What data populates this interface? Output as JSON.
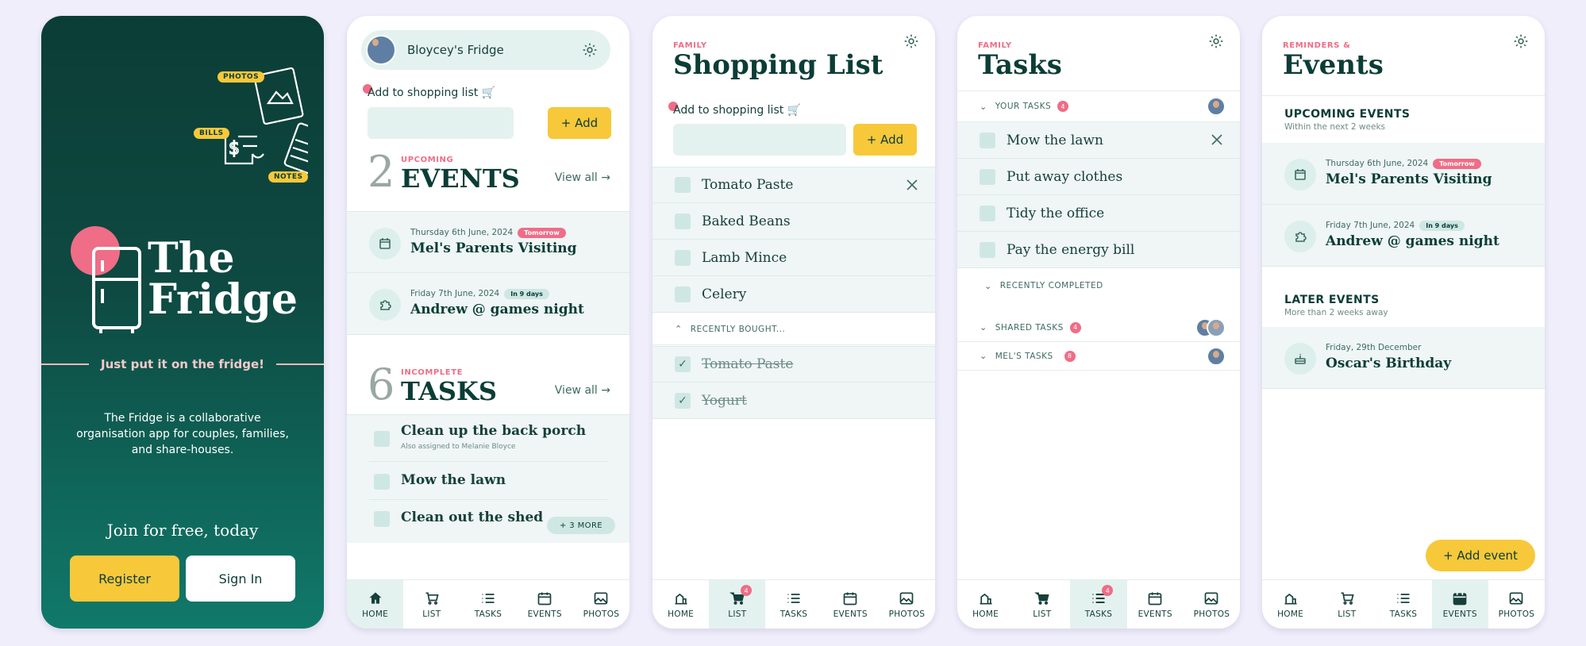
{
  "welcome": {
    "doodle_tags": [
      "PHOTOS",
      "BILLS",
      "NOTES"
    ],
    "logo_line1": "The",
    "logo_line2": "Fridge",
    "tagline": "Just put it on the fridge!",
    "about": "The Fridge is a collaborative organisation app for couples, families, and share-houses.",
    "join": "Join for free, today",
    "register": "Register",
    "sign_in": "Sign In"
  },
  "home": {
    "fridge_name": "Bloycey's Fridge",
    "add_label": "Add to shopping list",
    "add_btn": "+ Add",
    "events_count": "2",
    "events_kicker": "UPCOMING",
    "events_title": "EVENTS",
    "view_all": "View all →",
    "events": [
      {
        "date": "Thursday 6th June, 2024",
        "pill": "Tomorrow",
        "title": "Mel's Parents Visiting",
        "icon": "calendar-icon"
      },
      {
        "date": "Friday 7th June, 2024",
        "pill": "In 9 days",
        "title": "Andrew @ games night",
        "icon": "puzzle-icon"
      }
    ],
    "tasks_count": "6",
    "tasks_kicker": "INCOMPLETE",
    "tasks_title": "TASKS",
    "tasks": [
      {
        "title": "Clean up the back porch",
        "note": "Also assigned to Melanie Bloyce"
      },
      {
        "title": "Mow the lawn"
      },
      {
        "title": "Clean out the shed"
      }
    ],
    "more": "+ 3 MORE"
  },
  "shopping": {
    "kicker": "FAMILY",
    "title": "Shopping List",
    "add_label": "Add to shopping list",
    "add_btn": "+ Add",
    "items": [
      "Tomato Paste",
      "Baked Beans",
      "Lamb Mince",
      "Celery"
    ],
    "recent_header": "RECENTLY BOUGHT...",
    "bought": [
      "Tomato Paste",
      "Yogurt"
    ]
  },
  "tasks": {
    "kicker": "FAMILY",
    "title": "Tasks",
    "your_tasks": "YOUR TASKS",
    "your_count": "4",
    "items": [
      "Mow the lawn",
      "Put away clothes",
      "Tidy the office",
      "Pay the energy bill"
    ],
    "recently_completed": "RECENTLY COMPLETED",
    "shared_tasks": "SHARED TASKS",
    "shared_count": "4",
    "mels_tasks": "MEL'S TASKS",
    "mels_count": "8"
  },
  "events": {
    "kicker": "REMINDERS &",
    "title": "Events",
    "upcoming_h": "UPCOMING EVENTS",
    "upcoming_s": "Within the next 2 weeks",
    "upcoming": [
      {
        "date": "Thursday 6th June, 2024",
        "pill": "Tomorrow",
        "title": "Mel's Parents Visiting",
        "icon": "calendar-icon"
      },
      {
        "date": "Friday 7th June, 2024",
        "pill": "In 9 days",
        "title": "Andrew @ games night",
        "icon": "puzzle-icon"
      }
    ],
    "later_h": "LATER EVENTS",
    "later_s": "More than 2 weeks away",
    "later": [
      {
        "date": "Friday, 29th December",
        "title": "Oscar's Birthday",
        "icon": "cake-icon"
      }
    ],
    "add_event": "+ Add event"
  },
  "tabbar": {
    "labels": [
      "HOME",
      "LIST",
      "TASKS",
      "EVENTS",
      "PHOTOS"
    ],
    "list_badge": "4"
  },
  "colors": {
    "accent": "#f7c83a",
    "brand": "#0b3d36",
    "pink": "#ef6d86",
    "tint": "#e4f2ef"
  }
}
